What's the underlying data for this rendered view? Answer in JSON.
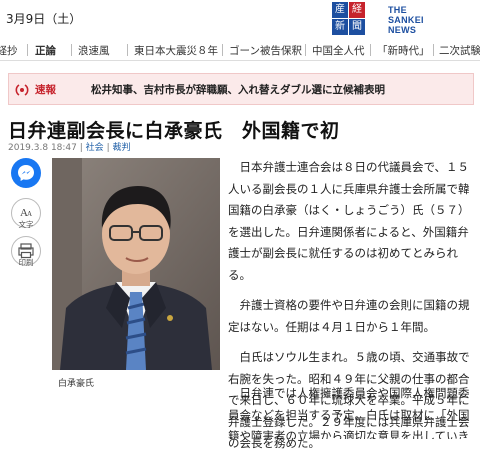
{
  "header": {
    "date": "3月9日（土）",
    "logo_kanji": [
      "産",
      "経",
      "新",
      "聞"
    ],
    "logo_line1": "THE",
    "logo_line2": "SANKEI",
    "logo_line3": "NEWS"
  },
  "nav": {
    "items": [
      "産経抄",
      "正論",
      "浪速風",
      "東日本大震災８年",
      "ゴーン被告保釈",
      "中国全人代",
      "「新時代」",
      "二次試験"
    ]
  },
  "breaking": {
    "label": "速報",
    "text": "松井知事、吉村市長が辞職願、入れ替えダブル選に立候補表明"
  },
  "article": {
    "title": "日弁連副会長に白承豪氏　外国籍で初",
    "datetime": "2019.3.8 18:47",
    "category1": "社会",
    "category2": "裁判",
    "caption": "白承豪氏",
    "paragraphs": [
      "日本弁護士連合会は８日の代議員会で、１５人いる副会長の１人に兵庫県弁護士会所属で韓国籍の白承豪（はく・しょうごう）氏（５７）を選出した。日弁連関係者によると、外国籍弁護士が副会長に就任するのは初めてとみられる。",
      "弁護士資格の要件や日弁連の会則に国籍の規定はない。任期は４月１日から１年間。",
      "白氏はソウル生まれ。５歳の頃、交通事故で右腕を失った。昭和４９年に父親の仕事の都合で来日し、６０年に琉球大を卒業。平成５年に弁護士登録した。２９年度には兵庫県弁護士会の会長を務めた。"
    ],
    "paragraph_last": "日弁連では人権擁護委員会や国際人権問題委員会などを担当する予定。白氏は取材に「外国籍や障害者の立場から適切な意見を出していきたい」と抱負を語った。"
  },
  "share": {
    "text_size_label": "文字",
    "print_label": "印刷"
  },
  "colors": {
    "accent_red": "#c6232c",
    "messenger_blue": "#1877f2",
    "link_blue": "#1f5fa7"
  }
}
